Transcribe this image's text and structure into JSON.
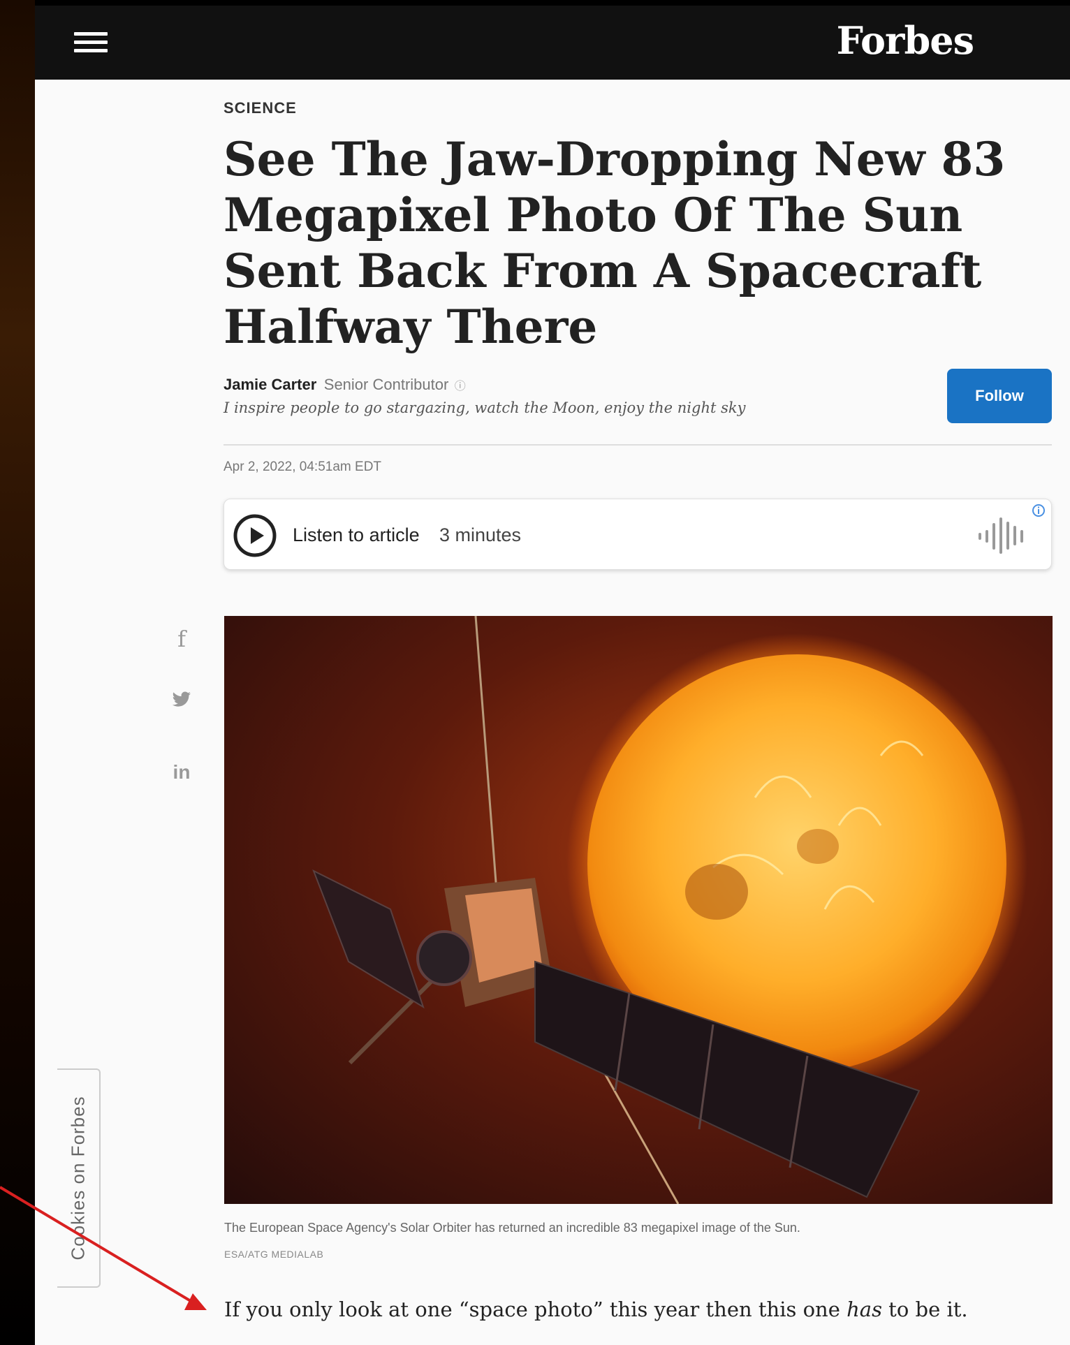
{
  "brand": {
    "name": "Forbes"
  },
  "article": {
    "section": "SCIENCE",
    "title": "See The Jaw-Dropping New 83 Megapixel Photo Of The Sun Sent Back From A Spacecraft Halfway There",
    "author": {
      "name": "Jamie Carter",
      "role": "Senior Contributor",
      "tagline": "I inspire people to go stargazing, watch the Moon, enjoy the night sky"
    },
    "follow_label": "Follow",
    "date": "Apr 2, 2022, 04:51am EDT",
    "audio": {
      "label": "Listen to article",
      "duration": "3 minutes"
    },
    "image": {
      "caption": "The European Space Agency's Solar Orbiter has returned an incredible 83 megapixel image of the Sun.",
      "credit": "ESA/ATG MEDIALAB"
    },
    "intro": {
      "before": "If you only look at one “space photo” this year then this one ",
      "emphasis": "has",
      "after": " to be it."
    }
  },
  "cookies_tab": {
    "label": "Cookies on Forbes"
  },
  "icons": [
    "menu-icon",
    "play-icon",
    "audio-wave-icon",
    "info-icon",
    "facebook-icon",
    "twitter-icon",
    "linkedin-icon"
  ],
  "colors": {
    "topbar": "#111111",
    "follow_button": "#1a73c4",
    "annotation_arrow": "#d92020"
  }
}
